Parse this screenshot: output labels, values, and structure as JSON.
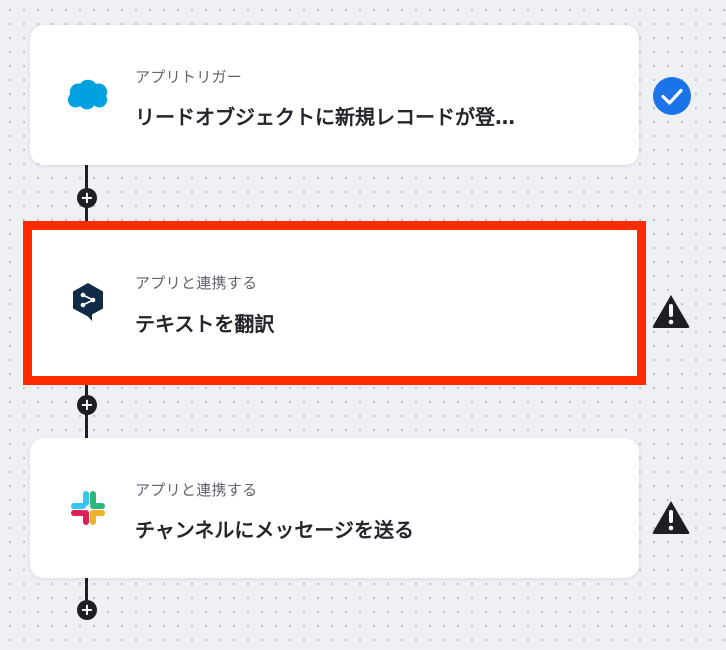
{
  "flow": {
    "steps": [
      {
        "category": "アプリトリガー",
        "title": "リードオブジェクトに新規レコードが登…",
        "app_icon": "salesforce-icon",
        "status_icon": "check-icon",
        "status": "complete"
      },
      {
        "category": "アプリと連携する",
        "title": "テキストを翻訳",
        "app_icon": "deepl-icon",
        "status_icon": "warning-icon",
        "status": "warning",
        "selected": true
      },
      {
        "category": "アプリと連携する",
        "title": "チャンネルにメッセージを送る",
        "app_icon": "slack-icon",
        "status_icon": "warning-icon",
        "status": "warning"
      }
    ],
    "add_step_label": "+"
  },
  "colors": {
    "highlight": "#ff2a00",
    "check_badge": "#1a73e8",
    "warning": "#1e1e24",
    "salesforce": "#00a1e0",
    "deepl": "#0f2b46",
    "slack": [
      "#e01e5a",
      "#36c5f0",
      "#2eb67d",
      "#ecb22e"
    ]
  }
}
